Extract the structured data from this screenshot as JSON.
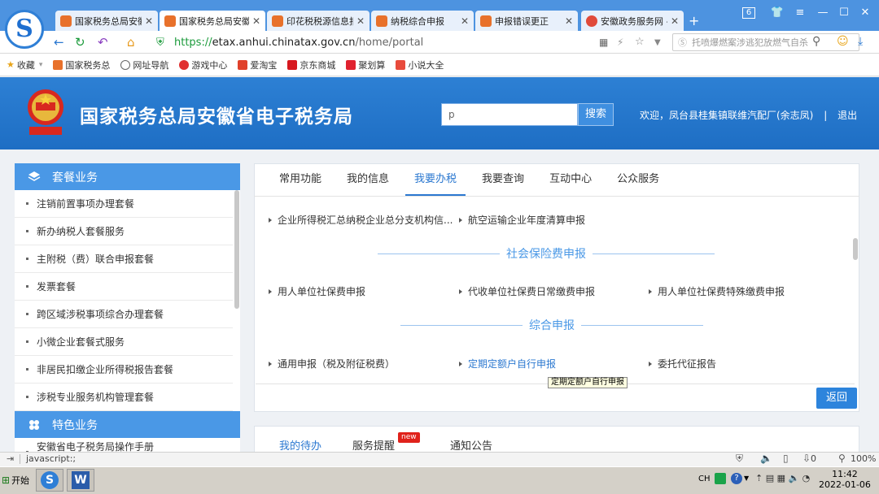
{
  "browser": {
    "tabs": [
      {
        "title": "国家税务总局安徽",
        "fav_color": "#e8712b"
      },
      {
        "title": "国家税务总局安徽",
        "fav_color": "#e8712b"
      },
      {
        "title": "印花税税源信息报",
        "fav_color": "#e8712b"
      },
      {
        "title": "纳税综合申报",
        "fav_color": "#e8712b"
      },
      {
        "title": "申报错误更正",
        "fav_color": "#e8712b"
      },
      {
        "title": "安徽政务服务网 -",
        "fav_color": "#e04a3a"
      }
    ],
    "tab_count": "6",
    "url_scheme": "https://",
    "url_host": "etax.anhui.chinatax.gov.cn",
    "url_path": "/home/portal",
    "search_placeholder": "托喷爆燃案涉逃犯放燃气自杀",
    "bookmarks": [
      "收藏",
      "国家税务总",
      "网址导航",
      "游戏中心",
      "爱淘宝",
      "京东商城",
      "聚划算",
      "小说大全"
    ]
  },
  "site": {
    "title": "国家税务总局安徽省电子税务局",
    "search_value": "p",
    "search_button": "搜索",
    "welcome": "欢迎，凤台县桂集镇联维汽配厂(余志凤)",
    "separator": "|",
    "logout": "退出"
  },
  "left_panel": {
    "section1": "套餐业务",
    "items": [
      "注销前置事项办理套餐",
      "新办纳税人套餐服务",
      "主附税（费）联合申报套餐",
      "发票套餐",
      "跨区域涉税事项综合办理套餐",
      "小微企业套餐式服务",
      "非居民扣缴企业所得税报告套餐",
      "涉税专业服务机构管理套餐"
    ],
    "section2": "特色业务",
    "partial_item": "安徽省电子税务局操作手册"
  },
  "main": {
    "tabs": [
      "常用功能",
      "我的信息",
      "我要办税",
      "我要查询",
      "互动中心",
      "公众服务"
    ],
    "selected_tab": "我要办税",
    "top_row": [
      "企业所得税汇总纳税企业总分支机构信...",
      "航空运输企业年度清算申报"
    ],
    "section_social": "社会保险费申报",
    "social_items": [
      "用人单位社保费申报",
      "代收单位社保费日常缴费申报",
      "用人单位社保费特殊缴费申报"
    ],
    "section_general": "综合申报",
    "general_items": [
      "通用申报（税及附征税费）",
      "定期定额户自行申报",
      "委托代征报告"
    ],
    "tooltip": "定期定额户自行申报",
    "back_button": "返回"
  },
  "lower": {
    "tabs": [
      "我的待办",
      "服务提醒",
      "通知公告"
    ],
    "badge": "new"
  },
  "status": {
    "left_text": "javascript:;",
    "count": "0",
    "zoom": "100%"
  },
  "taskbar": {
    "start": "开始",
    "lang": "CH",
    "time": "11:42",
    "date": "2022-01-06"
  }
}
